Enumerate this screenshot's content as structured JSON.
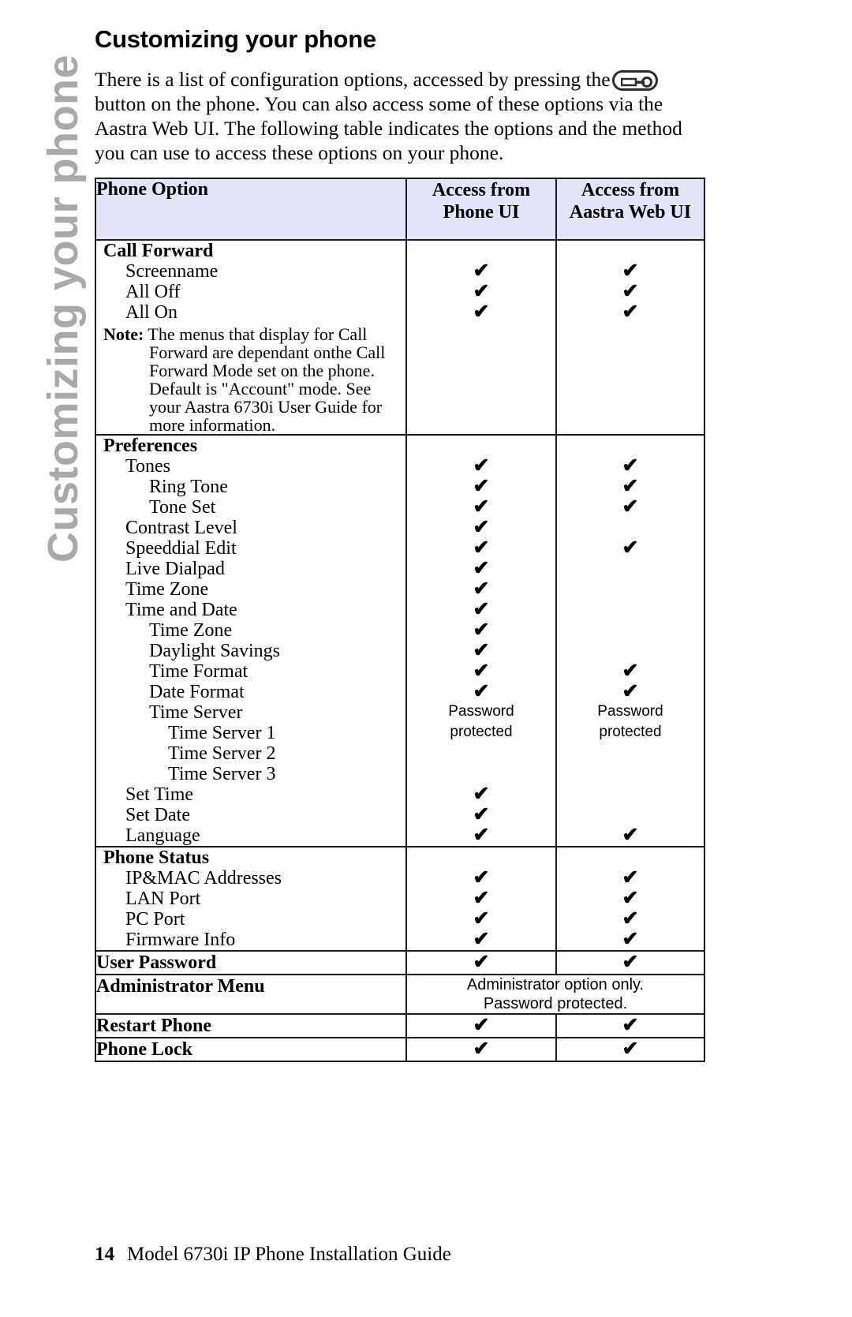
{
  "side_tab": {
    "label": "Customizing your phone",
    "color": "#a9a9a9"
  },
  "page": {
    "title": "Customizing your phone",
    "intro": {
      "line1_a": "There is a list of configuration options, accessed by pressing the",
      "icon": "options-button-icon",
      "line2": "button on the phone. You can also access some of these options via the",
      "line3": "Aastra Web UI. The following table indicates the options and the method",
      "line4": "you can use to access these options on your phone."
    }
  },
  "table": {
    "header_bg": "#e3e3f9",
    "columns": [
      {
        "label": "Phone Option"
      },
      {
        "label_line1": "Access from",
        "label_line2": "Phone UI"
      },
      {
        "label_line1": "Access from",
        "label_line2": "Aastra Web UI"
      }
    ],
    "check_glyph": "✔",
    "sections": [
      {
        "name": "call-forward",
        "rows": [
          {
            "label": "Call Forward",
            "level": 0,
            "bold": true,
            "phone": "",
            "web": ""
          },
          {
            "label": "Screenname",
            "level": 1,
            "bold": false,
            "phone": "check",
            "web": "check"
          },
          {
            "label": "All Off",
            "level": 1,
            "bold": false,
            "phone": "check",
            "web": "check"
          },
          {
            "label": "All On",
            "level": 1,
            "bold": false,
            "phone": "check",
            "web": "check"
          }
        ],
        "note": {
          "prefix": "Note:",
          "lines": [
            "The menus that display for Call",
            "Forward are dependant onthe Call",
            "Forward Mode set on the phone.",
            "Default is \"Account\" mode. See",
            "your Aastra 6730i User Guide for",
            "more information."
          ]
        }
      },
      {
        "name": "preferences",
        "rows": [
          {
            "label": "Preferences",
            "level": 0,
            "bold": true,
            "phone": "",
            "web": ""
          },
          {
            "label": "Tones",
            "level": 1,
            "bold": false,
            "phone": "check",
            "web": "check"
          },
          {
            "label": "Ring Tone",
            "level": 2,
            "bold": false,
            "phone": "check",
            "web": "check"
          },
          {
            "label": "Tone Set",
            "level": 2,
            "bold": false,
            "phone": "check",
            "web": "check"
          },
          {
            "label": "Contrast Level",
            "level": 1,
            "bold": false,
            "phone": "check",
            "web": ""
          },
          {
            "label": "Speeddial Edit",
            "level": 1,
            "bold": false,
            "phone": "check",
            "web": "check"
          },
          {
            "label": "Live Dialpad",
            "level": 1,
            "bold": false,
            "phone": "check",
            "web": ""
          },
          {
            "label": "Time Zone",
            "level": 1,
            "bold": false,
            "phone": "check",
            "web": ""
          },
          {
            "label": "Time and Date",
            "level": 1,
            "bold": false,
            "phone": "check",
            "web": ""
          },
          {
            "label": "Time Zone",
            "level": 2,
            "bold": false,
            "phone": "check",
            "web": ""
          },
          {
            "label": "Daylight Savings",
            "level": 2,
            "bold": false,
            "phone": "check",
            "web": ""
          },
          {
            "label": "Time Format",
            "level": 2,
            "bold": false,
            "phone": "check",
            "web": "check"
          },
          {
            "label": "Date Format",
            "level": 2,
            "bold": false,
            "phone": "check",
            "web": "check"
          },
          {
            "label": "Time Server",
            "level": 2,
            "bold": false,
            "phone": "Password",
            "web": "Password"
          },
          {
            "label": "Time Server 1",
            "level": 3,
            "bold": false,
            "phone": "protected",
            "web": "protected"
          },
          {
            "label": "Time Server 2",
            "level": 3,
            "bold": false,
            "phone": "",
            "web": ""
          },
          {
            "label": "Time Server 3",
            "level": 3,
            "bold": false,
            "phone": "",
            "web": ""
          },
          {
            "label": "Set Time",
            "level": 1,
            "bold": false,
            "phone": "check",
            "web": ""
          },
          {
            "label": "Set Date",
            "level": 1,
            "bold": false,
            "phone": "check",
            "web": ""
          },
          {
            "label": "Language",
            "level": 1,
            "bold": false,
            "phone": "check",
            "web": "check"
          }
        ]
      },
      {
        "name": "phone-status",
        "rows": [
          {
            "label": "Phone Status",
            "level": 0,
            "bold": true,
            "phone": "",
            "web": ""
          },
          {
            "label": "IP&MAC Addresses",
            "level": 1,
            "bold": false,
            "phone": "check",
            "web": "check"
          },
          {
            "label": "LAN Port",
            "level": 1,
            "bold": false,
            "phone": "check",
            "web": "check"
          },
          {
            "label": "PC Port",
            "level": 1,
            "bold": false,
            "phone": "check",
            "web": "check"
          },
          {
            "label": "Firmware Info",
            "level": 1,
            "bold": false,
            "phone": "check",
            "web": "check"
          }
        ]
      }
    ],
    "simple_rows": [
      {
        "name": "user-password",
        "label": "User Password",
        "phone": "check",
        "web": "check",
        "span": ""
      },
      {
        "name": "administrator-menu",
        "label": "Administrator Menu",
        "phone": "",
        "web": "",
        "span": "Administrator option only.\nPassword protected."
      },
      {
        "name": "restart-phone",
        "label": "Restart Phone",
        "phone": "check",
        "web": "check",
        "span": ""
      },
      {
        "name": "phone-lock",
        "label": "Phone Lock",
        "phone": "check",
        "web": "check",
        "span": ""
      }
    ]
  },
  "footer": {
    "page_number": "14",
    "guide_title": "Model 6730i IP Phone Installation Guide"
  }
}
